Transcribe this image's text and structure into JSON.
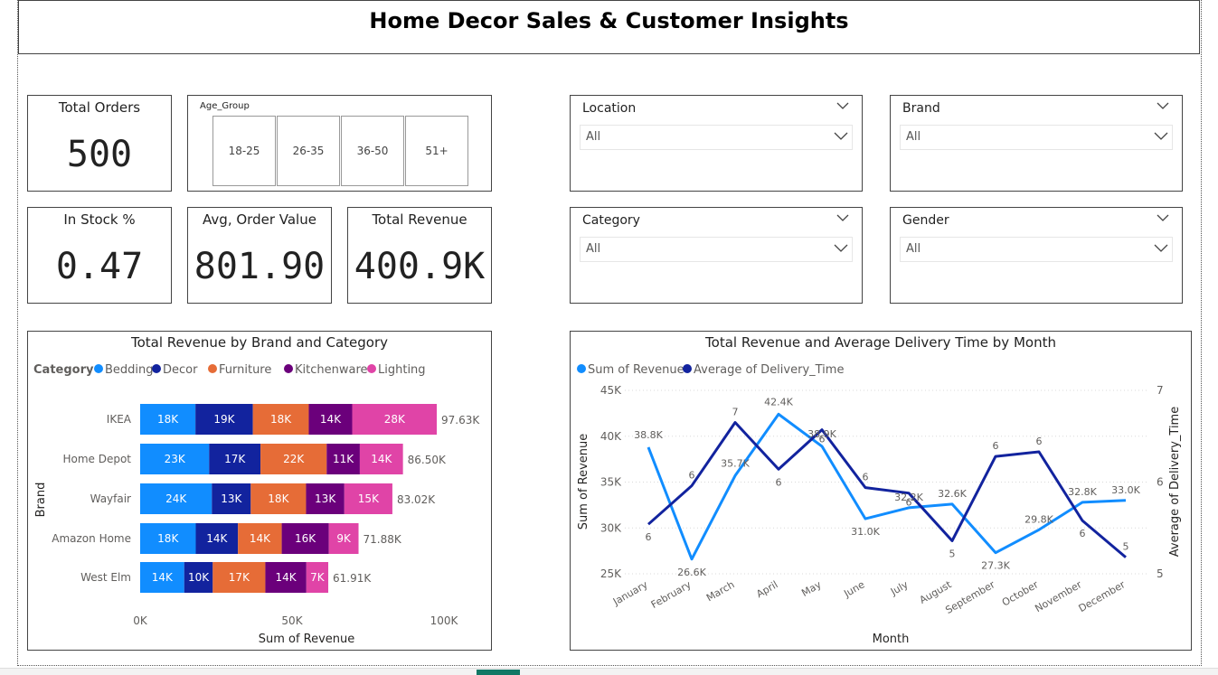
{
  "title": "Home Decor Sales & Customer Insights",
  "colors": {
    "bedding": "#118DFF",
    "decor": "#12239E",
    "furniture": "#E66C37",
    "kitchenware": "#6B007B",
    "lighting": "#E044A7",
    "revenue_line": "#118DFF",
    "delivery_line": "#12239E"
  },
  "kpis": {
    "total_orders": {
      "label": "Total Orders",
      "value": "500"
    },
    "in_stock": {
      "label": "In Stock %",
      "value": "0.47"
    },
    "avg_order_value": {
      "label": "Avg, Order Value",
      "value": "801.90"
    },
    "total_revenue": {
      "label": "Total Revenue",
      "value": "400.9K"
    }
  },
  "age_slicer": {
    "title": "Age_Group",
    "options": [
      "18-25",
      "26-35",
      "36-50",
      "51+"
    ]
  },
  "filters": {
    "location": {
      "label": "Location",
      "value": "All"
    },
    "brand": {
      "label": "Brand",
      "value": "All"
    },
    "category": {
      "label": "Category",
      "value": "All"
    },
    "gender": {
      "label": "Gender",
      "value": "All"
    }
  },
  "icons": {
    "dropdown": "chevron-down-icon"
  },
  "chart_data": [
    {
      "type": "bar",
      "orientation": "horizontal-stacked",
      "title": "Total Revenue by Brand and Category",
      "xlabel": "Sum of Revenue",
      "ylabel": "Brand",
      "legend_title": "Category",
      "legend_position": "top-left",
      "xlim": [
        0,
        100000
      ],
      "xticks": [
        "0K",
        "50K",
        "100K"
      ],
      "categories": [
        "IKEA",
        "Home Depot",
        "Wayfair",
        "Amazon Home",
        "West Elm"
      ],
      "series": [
        {
          "name": "Bedding",
          "values": [
            18.2,
            22.7,
            23.6,
            18.3,
            14.5
          ],
          "labels": [
            "18K",
            "23K",
            "24K",
            "18K",
            "14K"
          ]
        },
        {
          "name": "Decor",
          "values": [
            18.9,
            16.9,
            12.8,
            13.9,
            9.4
          ],
          "labels": [
            "19K",
            "17K",
            "13K",
            "14K",
            "10K"
          ]
        },
        {
          "name": "Furniture",
          "values": [
            18.4,
            21.8,
            18.2,
            14.4,
            17.3
          ],
          "labels": [
            "18K",
            "22K",
            "18K",
            "14K",
            "17K"
          ]
        },
        {
          "name": "Kitchenware",
          "values": [
            14.3,
            10.9,
            12.6,
            15.5,
            13.5
          ],
          "labels": [
            "14K",
            "11K",
            "13K",
            "16K",
            "14K"
          ]
        },
        {
          "name": "Lighting",
          "values": [
            27.83,
            14.2,
            15.82,
            9.78,
            7.21
          ],
          "labels": [
            "28K",
            "14K",
            "15K",
            "9K",
            "7K"
          ]
        }
      ],
      "totals": [
        97.63,
        86.5,
        83.02,
        71.88,
        61.91
      ],
      "total_labels": [
        "97.63K",
        "86.50K",
        "83.02K",
        "71.88K",
        "61.91K"
      ]
    },
    {
      "type": "line",
      "title": "Total Revenue and Average Delivery Time by Month",
      "xlabel": "Month",
      "ylabel": "Sum of Revenue",
      "y2label": "Average of Delivery_Time",
      "legend_position": "top-left",
      "x": [
        "January",
        "February",
        "March",
        "April",
        "May",
        "June",
        "July",
        "August",
        "September",
        "October",
        "November",
        "December"
      ],
      "ylim": [
        25000,
        45000
      ],
      "yticks": [
        "25K",
        "30K",
        "35K",
        "40K",
        "45K"
      ],
      "y2lim": [
        5,
        7
      ],
      "y2ticks": [
        "5",
        "6",
        "7"
      ],
      "series": [
        {
          "name": "Sum of Revenue",
          "axis": "left",
          "values": [
            38.8,
            26.6,
            35.7,
            42.4,
            38.9,
            31.0,
            32.2,
            32.6,
            27.3,
            29.8,
            32.8,
            33.0
          ],
          "labels": [
            "38.8K",
            "26.6K",
            "35.7K",
            "42.4K",
            "38.9K",
            "31.0K",
            "32.2K",
            "32.6K",
            "27.3K",
            "29.8K",
            "32.8K",
            "33.0K"
          ]
        },
        {
          "name": "Average of Delivery_Time",
          "axis": "right",
          "values": [
            5.54,
            5.96,
            6.65,
            6.14,
            6.57,
            5.94,
            5.88,
            5.36,
            6.28,
            6.33,
            5.58,
            5.18
          ],
          "labels": [
            "6",
            "6",
            "7",
            "6",
            "6",
            "6",
            "6",
            "5",
            "6",
            "6",
            "6",
            "5"
          ]
        }
      ]
    }
  ]
}
